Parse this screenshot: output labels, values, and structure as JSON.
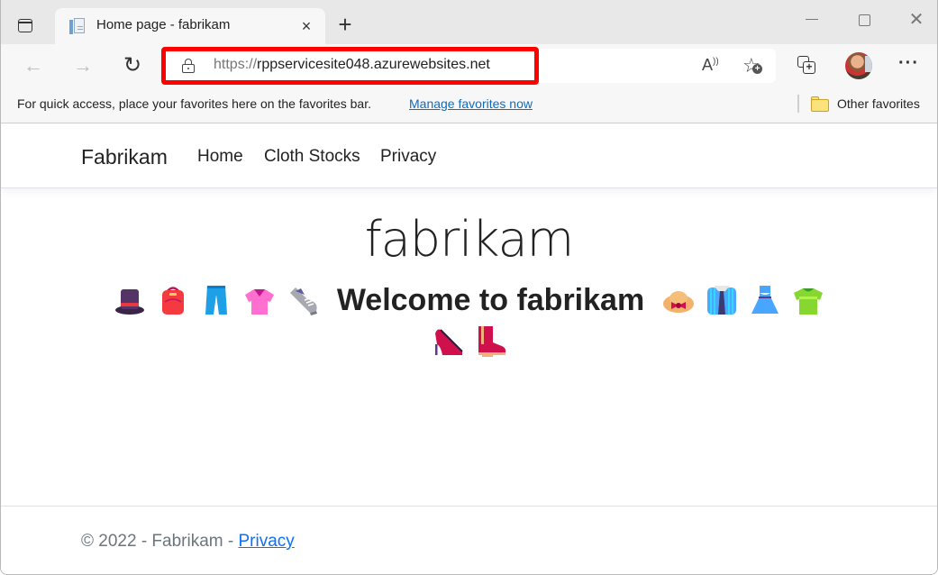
{
  "browser": {
    "tab": {
      "title": "Home page - fabrikam",
      "close_glyph": "×"
    },
    "new_tab_glyph": "+",
    "window_controls": {
      "minimize": "minimize",
      "maximize": "maximize",
      "close_glyph": "✕"
    },
    "toolbar": {
      "back_glyph": "←",
      "forward_glyph": "→",
      "refresh_glyph": "↻",
      "url_scheme": "https://",
      "url_host": "rppservicesite048.azurewebsites.net",
      "read_aloud_glyph": "A",
      "favorite_glyph": "☆",
      "favorite_plus": "+",
      "collections_plus": "+",
      "more_glyph": "···"
    },
    "favorites_bar": {
      "hint": "For quick access, place your favorites here on the favorites bar.",
      "manage_link": "Manage favorites now",
      "other_favorites": "Other favorites"
    },
    "accent_colors": {
      "highlight_box": "#ff0000",
      "link": "#0f6cbd"
    }
  },
  "site": {
    "brand": "Fabrikam",
    "nav": [
      {
        "label": "Home"
      },
      {
        "label": "Cloth Stocks"
      },
      {
        "label": "Privacy"
      }
    ],
    "hero_title": "fabrikam",
    "welcome": "Welcome to fabrikam",
    "emojis_left": [
      "top-hat",
      "backpack",
      "jeans",
      "blouse",
      "running-shoe"
    ],
    "emojis_right": [
      "womans-hat",
      "shirt-tie",
      "dress",
      "t-shirt"
    ],
    "emojis_line2": [
      "high-heel",
      "womans-boot"
    ],
    "footer": {
      "copyright": "© 2022 - Fabrikam - ",
      "privacy_link": "Privacy"
    }
  }
}
